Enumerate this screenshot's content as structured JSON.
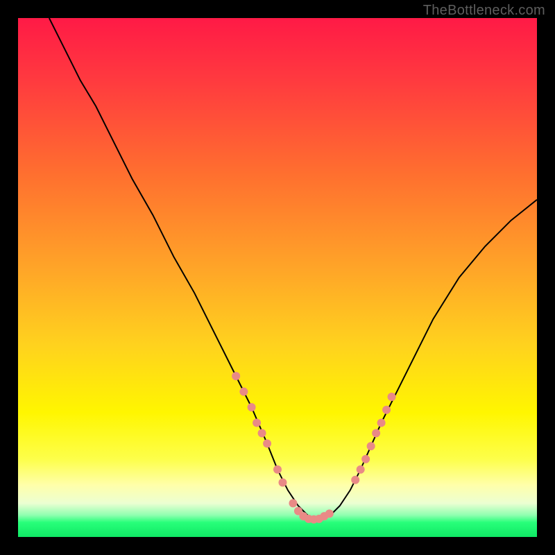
{
  "watermark": "TheBottleneck.com",
  "chart_data": {
    "type": "line",
    "title": "",
    "xlabel": "",
    "ylabel": "",
    "xlim": [
      0,
      100
    ],
    "ylim": [
      0,
      100
    ],
    "grid": false,
    "legend": false,
    "gradient_bands": {
      "red_top_hex": "#ff1a46",
      "orange_mid_hex": "#ffb72d",
      "yellow_hex": "#fff600",
      "pale_yellow_hex": "#ffffaa",
      "green_hex": "#28ff7a",
      "bottom_green_position_percent": 97
    },
    "curve_note": "V-shaped black curve starting near top-left, reaching minimum around x≈55%, rising toward right",
    "curve": {
      "x": [
        6,
        8,
        10,
        12,
        15,
        18,
        22,
        26,
        30,
        34,
        38,
        42,
        45,
        48,
        50,
        52,
        54,
        56,
        58,
        60,
        62,
        64,
        66,
        70,
        75,
        80,
        85,
        90,
        95,
        100
      ],
      "y": [
        100,
        96,
        92,
        88,
        83,
        77,
        69,
        62,
        54,
        47,
        39,
        31,
        25,
        18,
        13,
        9,
        6,
        4,
        3.5,
        4,
        6,
        9,
        13,
        22,
        32,
        42,
        50,
        56,
        61,
        65
      ]
    },
    "marker_note": "small salmon-colored dots overlaid on lower portion of V, both sides near the trough",
    "markers": {
      "color_hex": "#e98a86",
      "radius_px": 6,
      "points": [
        {
          "x": 42,
          "y": 31
        },
        {
          "x": 43.5,
          "y": 28
        },
        {
          "x": 45,
          "y": 25
        },
        {
          "x": 46,
          "y": 22
        },
        {
          "x": 47,
          "y": 20
        },
        {
          "x": 48,
          "y": 18
        },
        {
          "x": 50,
          "y": 13
        },
        {
          "x": 51,
          "y": 10.5
        },
        {
          "x": 53,
          "y": 6.5
        },
        {
          "x": 54,
          "y": 5
        },
        {
          "x": 55,
          "y": 4
        },
        {
          "x": 56,
          "y": 3.5
        },
        {
          "x": 57,
          "y": 3.4
        },
        {
          "x": 58,
          "y": 3.5
        },
        {
          "x": 59,
          "y": 4
        },
        {
          "x": 60,
          "y": 4.5
        },
        {
          "x": 65,
          "y": 11
        },
        {
          "x": 66,
          "y": 13
        },
        {
          "x": 67,
          "y": 15
        },
        {
          "x": 68,
          "y": 17.5
        },
        {
          "x": 69,
          "y": 20
        },
        {
          "x": 70,
          "y": 22
        },
        {
          "x": 71,
          "y": 24.5
        },
        {
          "x": 72,
          "y": 27
        }
      ]
    }
  }
}
